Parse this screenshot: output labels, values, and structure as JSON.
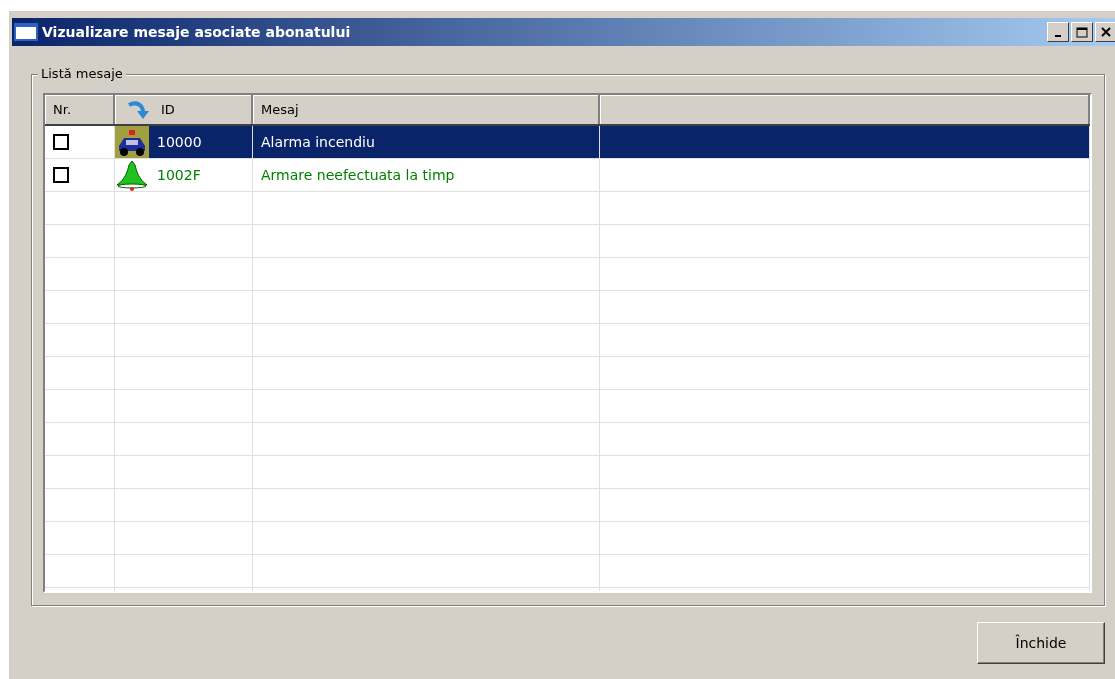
{
  "window": {
    "title": "Vizualizare mesaje asociate abonatului"
  },
  "group": {
    "label": "Listă mesaje"
  },
  "table": {
    "columns": [
      "Nr.",
      "ID",
      "Mesaj"
    ],
    "rows": [
      {
        "kind": "car",
        "checked": false,
        "selected": true,
        "id": "10000",
        "message": "Alarma incendiu"
      },
      {
        "kind": "bell",
        "checked": false,
        "selected": false,
        "color": "#008000",
        "id": "1002F",
        "message": "Armare neefectuata la timp"
      }
    ]
  },
  "buttons": [
    {
      "label": "Închide"
    }
  ]
}
